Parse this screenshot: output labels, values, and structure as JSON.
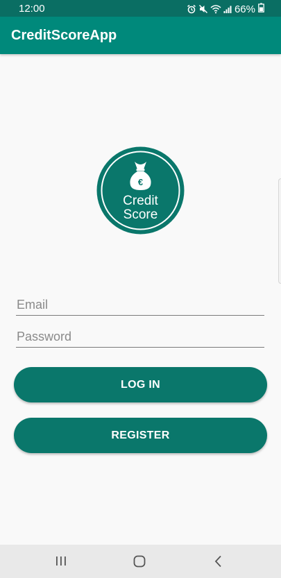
{
  "status_bar": {
    "time": "12:00",
    "battery": "66%",
    "icons": [
      "alarm-icon",
      "mute-icon",
      "wifi-icon",
      "signal-icon",
      "battery-icon"
    ]
  },
  "app_bar": {
    "title": "CreditScoreApp"
  },
  "logo": {
    "line1": "Credit",
    "line2": "Score",
    "bag_symbol": "€",
    "color": "#0a776b"
  },
  "form": {
    "email_placeholder": "Email",
    "email_value": "",
    "password_placeholder": "Password",
    "password_value": ""
  },
  "buttons": {
    "login_label": "LOG IN",
    "register_label": "REGISTER"
  },
  "nav_bar": {
    "icons": [
      "recents-icon",
      "home-icon",
      "back-icon"
    ]
  },
  "colors": {
    "primary": "#00897b",
    "primary_dark": "#0a6e63",
    "button": "#0a776b",
    "background": "#f9f9f9"
  }
}
